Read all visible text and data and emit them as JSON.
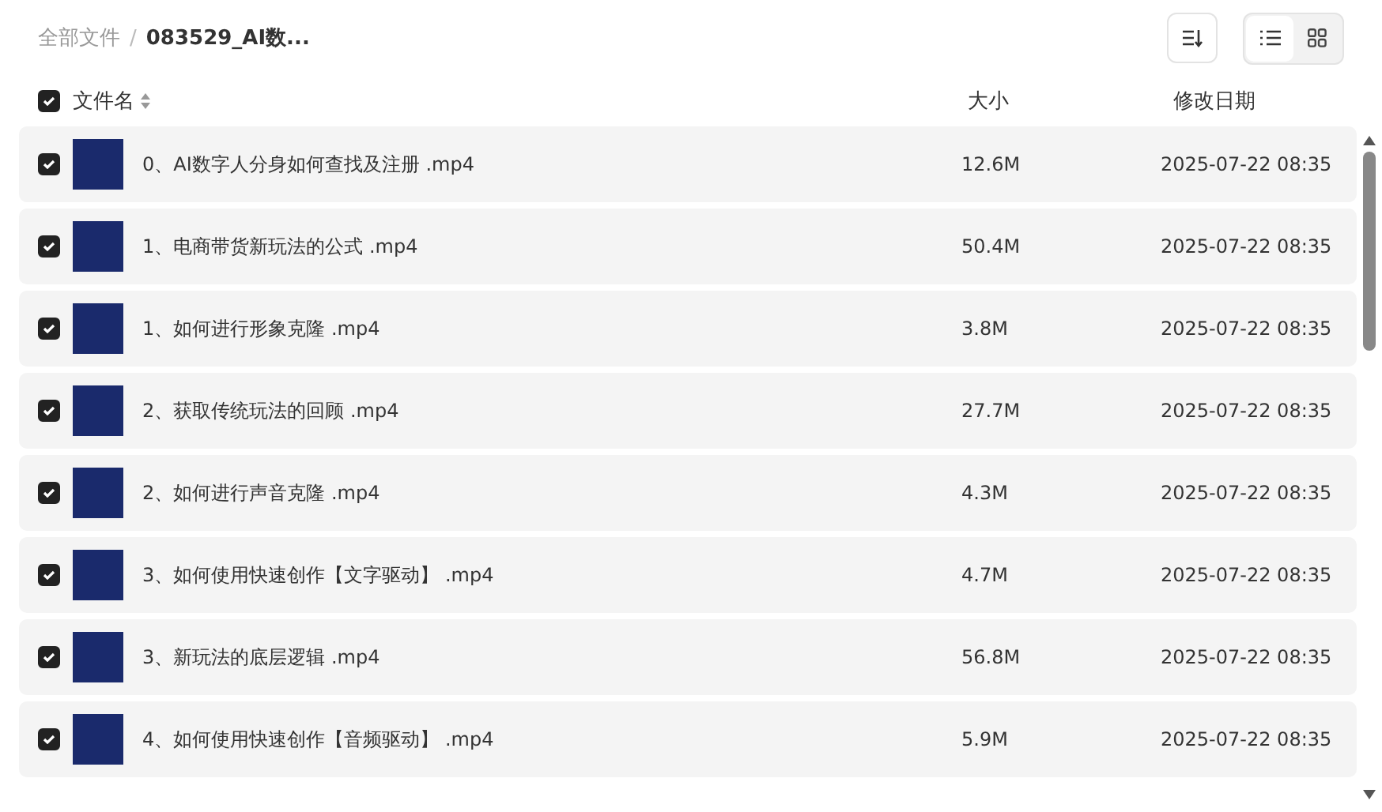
{
  "breadcrumb": {
    "root": "全部文件",
    "separator": "/",
    "current": "083529_AI数..."
  },
  "view_toggle": [
    {
      "kind": "list",
      "selected": true
    },
    {
      "kind": "grid",
      "selected": false
    }
  ],
  "table": {
    "all_checked": true,
    "columns": [
      "文件名",
      "大小",
      "修改日期"
    ],
    "rows": [
      {
        "name": "0、AI数字人分身如何查找及注册 .mp4",
        "size": "12.6M",
        "modified": "2025-07-22 08:35",
        "checked": true
      },
      {
        "name": "1、电商带货新玩法的公式 .mp4",
        "size": "50.4M",
        "modified": "2025-07-22 08:35",
        "checked": true
      },
      {
        "name": "1、如何进行形象克隆 .mp4",
        "size": "3.8M",
        "modified": "2025-07-22 08:35",
        "checked": true
      },
      {
        "name": "2、获取传统玩法的回顾 .mp4",
        "size": "27.7M",
        "modified": "2025-07-22 08:35",
        "checked": true
      },
      {
        "name": "2、如何进行声音克隆 .mp4",
        "size": "4.3M",
        "modified": "2025-07-22 08:35",
        "checked": true
      },
      {
        "name": "3、如何使用快速创作【文字驱动】 .mp4",
        "size": "4.7M",
        "modified": "2025-07-22 08:35",
        "checked": true
      },
      {
        "name": "3、新玩法的底层逻辑 .mp4",
        "size": "56.8M",
        "modified": "2025-07-22 08:35",
        "checked": true
      },
      {
        "name": "4、如何使用快速创作【音频驱动】 .mp4",
        "size": "5.9M",
        "modified": "2025-07-22 08:35",
        "checked": true
      }
    ]
  }
}
